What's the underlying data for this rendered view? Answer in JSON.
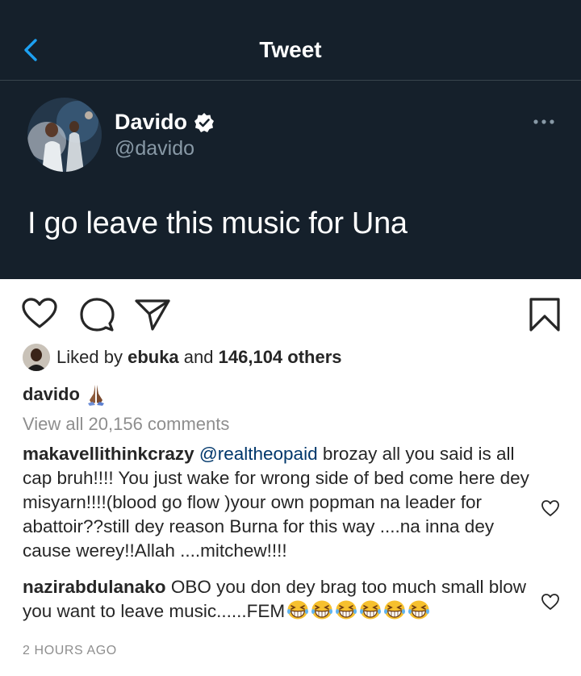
{
  "tweet": {
    "header_title": "Tweet",
    "author_name": "Davido",
    "author_handle": "@davido",
    "text": "I go leave this music for Una",
    "colors": {
      "background": "#15202b",
      "accent": "#1da1f2",
      "secondary_text": "#8899a6"
    }
  },
  "post": {
    "likes": {
      "prefix": "Liked by",
      "liker": "ebuka",
      "conjunction": "and",
      "others": "146,104 others"
    },
    "caption": {
      "username": "davido",
      "emoji": "folded-hands-emoji"
    },
    "view_all_comments": "View all 20,156 comments",
    "comments": [
      {
        "username": "makavellithinkcrazy",
        "mention": "@realtheopaid",
        "text": "brozay all you said is all cap bruh!!!! You just wake for wrong side of bed come here dey misyarn!!!!(blood go flow )your own popman na leader for abattoir??still dey reason Burna for this way ....na inna dey cause werey!!Allah ....mitchew!!!!"
      },
      {
        "username": "nazirabdulanako",
        "text": "OBO you don dey brag too much small blow you want to leave music......FEM",
        "emoji": "grinning-squinting-face-emoji",
        "emoji_count": 6
      }
    ],
    "timestamp": "2 HOURS AGO"
  }
}
